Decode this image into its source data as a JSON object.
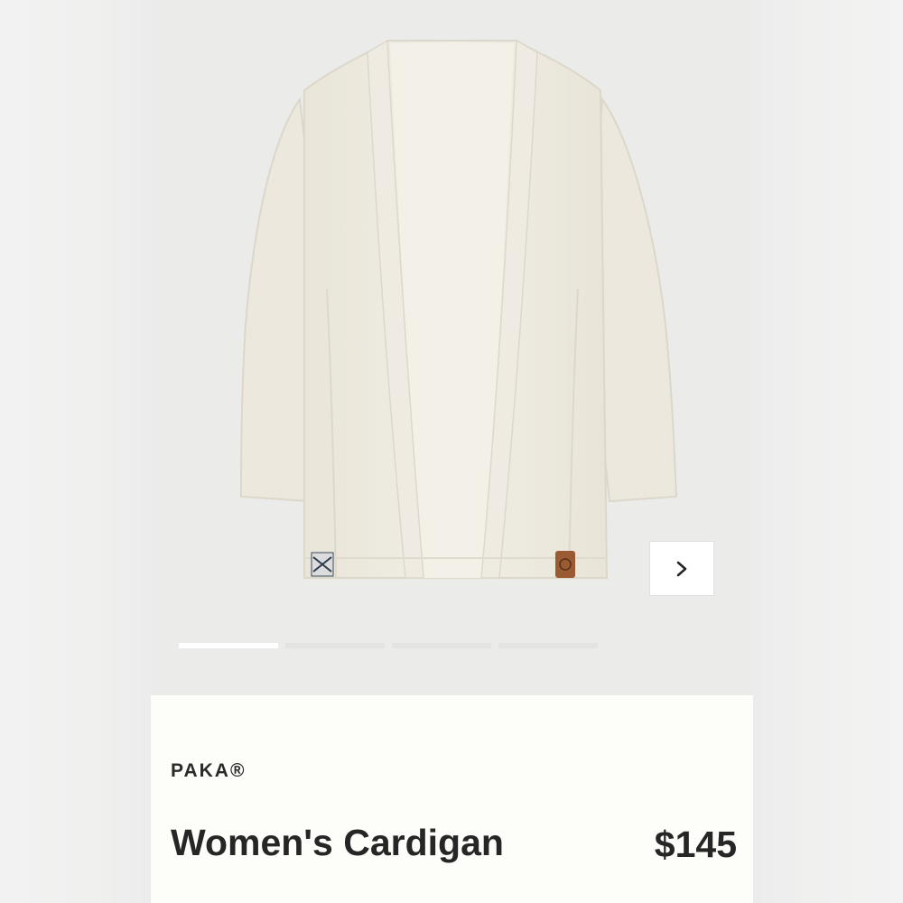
{
  "product": {
    "brand": "PAKA®",
    "title": "Women's Cardigan",
    "price": "$145",
    "image": {
      "subject": "cream cardigan",
      "garment_color": "#eeebe1",
      "background_color": "#ebebea"
    }
  },
  "gallery": {
    "next_icon": "chevron-right-icon",
    "pager": {
      "total": 4,
      "active_index": 0
    }
  }
}
